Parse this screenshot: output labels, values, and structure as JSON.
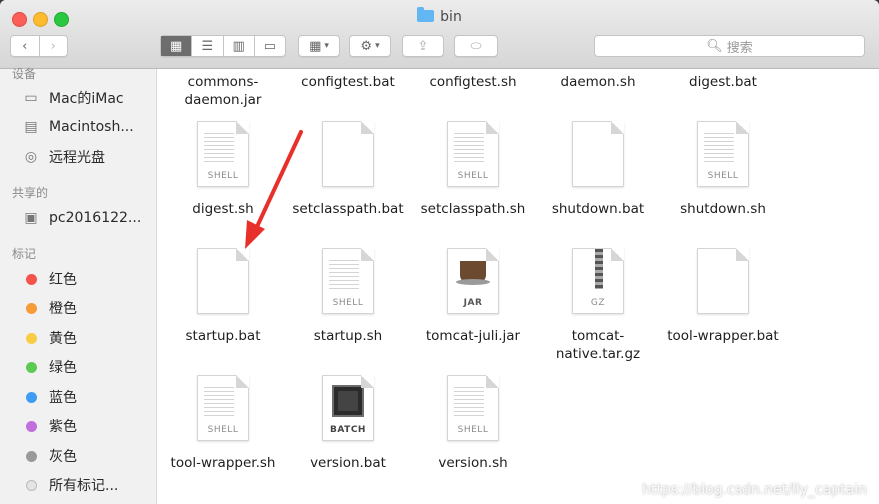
{
  "window": {
    "title": "bin"
  },
  "toolbar": {
    "back_icon": "chevron-left-icon",
    "forward_icon": "chevron-right-icon",
    "views": [
      "icon-view",
      "list-view",
      "column-view",
      "gallery-view"
    ],
    "search_placeholder": "搜索"
  },
  "sidebar": {
    "devices_header": "设备",
    "devices": [
      {
        "label": "Mac的iMac",
        "icon": "imac-icon"
      },
      {
        "label": "Macintosh...",
        "icon": "hard-drive-icon"
      },
      {
        "label": "远程光盘",
        "icon": "disc-icon"
      }
    ],
    "shared_header": "共享的",
    "shared": [
      {
        "label": "pc2016122...",
        "icon": "computer-icon"
      }
    ],
    "tags_header": "标记",
    "tags": [
      {
        "label": "红色",
        "color": "#f5544d"
      },
      {
        "label": "橙色",
        "color": "#f79a38"
      },
      {
        "label": "黄色",
        "color": "#f8cd45"
      },
      {
        "label": "绿色",
        "color": "#5bcb54"
      },
      {
        "label": "蓝色",
        "color": "#3e9cf5"
      },
      {
        "label": "紫色",
        "color": "#c06fdc"
      },
      {
        "label": "灰色",
        "color": "#9a9a9a"
      },
      {
        "label": "所有标记...",
        "color": "#e4e4e4"
      }
    ]
  },
  "files_row0": [
    {
      "line1": "commons-",
      "line2": "daemon.jar"
    },
    {
      "line1": "configtest.bat",
      "line2": ""
    },
    {
      "line1": "configtest.sh",
      "line2": ""
    },
    {
      "line1": "daemon.sh",
      "line2": ""
    },
    {
      "line1": "digest.bat",
      "line2": ""
    }
  ],
  "files": [
    {
      "line1": "digest.sh",
      "line2": "",
      "tag": "SHELL",
      "kind": "shell"
    },
    {
      "line1": "setclasspath.bat",
      "line2": "",
      "tag": "",
      "kind": "blank"
    },
    {
      "line1": "setclasspath.sh",
      "line2": "",
      "tag": "SHELL",
      "kind": "shell"
    },
    {
      "line1": "shutdown.bat",
      "line2": "",
      "tag": "",
      "kind": "blank"
    },
    {
      "line1": "shutdown.sh",
      "line2": "",
      "tag": "SHELL",
      "kind": "shell"
    },
    {
      "line1": "startup.bat",
      "line2": "",
      "tag": "",
      "kind": "blank"
    },
    {
      "line1": "startup.sh",
      "line2": "",
      "tag": "SHELL",
      "kind": "shell"
    },
    {
      "line1": "tomcat-juli.jar",
      "line2": "",
      "tag": "JAR",
      "kind": "jar"
    },
    {
      "line1": "tomcat-",
      "line2": "native.tar.gz",
      "tag": "GZ",
      "kind": "gz"
    },
    {
      "line1": "tool-wrapper.bat",
      "line2": "",
      "tag": "",
      "kind": "blank"
    },
    {
      "line1": "tool-wrapper.sh",
      "line2": "",
      "tag": "SHELL",
      "kind": "shell"
    },
    {
      "line1": "version.bat",
      "line2": "",
      "tag": "BATCH",
      "kind": "batch"
    },
    {
      "line1": "version.sh",
      "line2": "",
      "tag": "SHELL",
      "kind": "shell"
    }
  ],
  "watermark": "https://blog.csdn.net/lly_captain"
}
